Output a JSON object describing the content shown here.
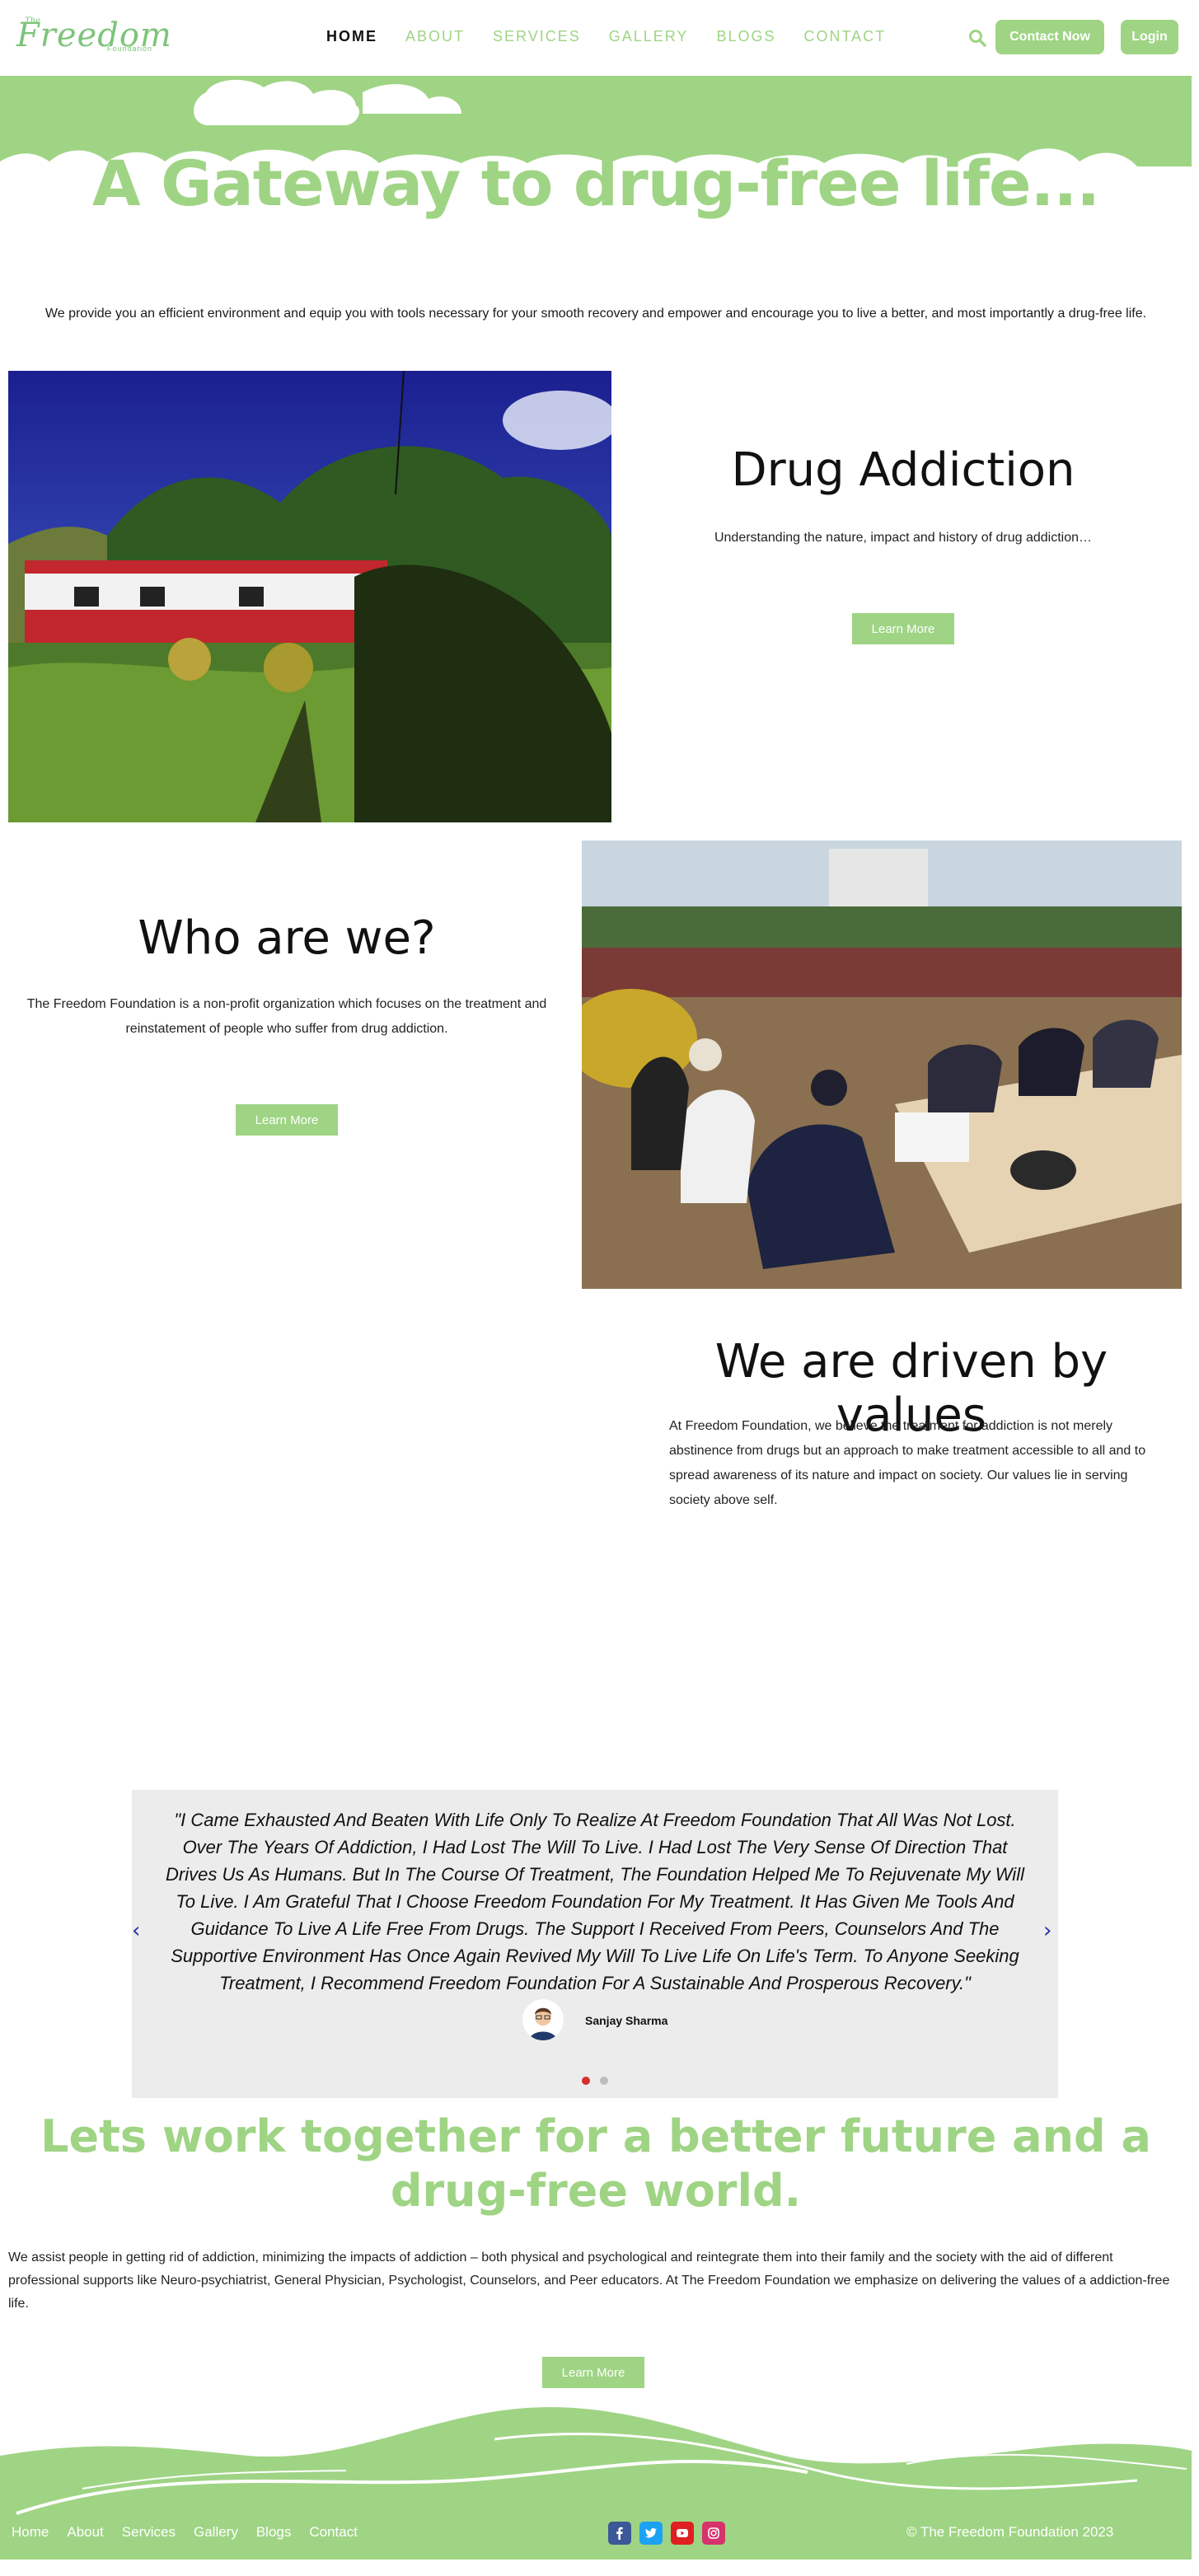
{
  "header": {
    "logo": {
      "small": "The",
      "main": "Freedom",
      "sub": "Foundation"
    },
    "nav": [
      {
        "label": "HOME",
        "active": true
      },
      {
        "label": "ABOUT",
        "active": false
      },
      {
        "label": "SERVICES",
        "active": false
      },
      {
        "label": "GALLERY",
        "active": false
      },
      {
        "label": "BLOGS",
        "active": false
      },
      {
        "label": "CONTACT",
        "active": false
      }
    ],
    "search_icon": "search-icon",
    "contact_button": "Contact Now",
    "login_button": "Login"
  },
  "hero": {
    "title": "A Gateway to drug-free life...",
    "intro": "We provide you an efficient environment and equip you with tools necessary for your smooth recovery and empower and encourage you to live a better, and most importantly a drug-free life."
  },
  "drug_addiction": {
    "title": "Drug Addiction",
    "text": "Understanding the nature, impact and history of drug addiction…",
    "button": "Learn More"
  },
  "who_are_we": {
    "title": "Who are we?",
    "text": "The Freedom Foundation is a non-profit organization which focuses on the treatment and reinstatement of people who suffer from drug addiction.",
    "button": "Learn More"
  },
  "values": {
    "title": "We are driven by values",
    "text": "At Freedom Foundation, we believe the treatment for addiction is not merely abstinence from drugs but an approach to make treatment accessible to all and to spread awareness of its nature and impact on society. Our values lie in serving society above self."
  },
  "testimonial": {
    "quote": "\"I Came Exhausted And Beaten With Life Only To Realize At Freedom Foundation That All Was Not Lost. Over The Years Of Addiction, I Had Lost The Will To Live. I Had Lost The Very Sense Of Direction That Drives Us As Humans. But In The Course Of Treatment, The Foundation Helped Me To Rejuvenate My Will To Live. I Am Grateful That I Choose Freedom Foundation For My Treatment. It Has Given Me Tools And Guidance To Live A Life Free From Drugs. The Support I Received From Peers, Counselors And The Supportive Environment Has Once Again Revived My Will To Live Life On Life's Term. To Anyone Seeking Treatment, I Recommend Freedom Foundation For A Sustainable And Prosperous Recovery.\"",
    "author": "Sanjay Sharma",
    "prev_arrow": "‹",
    "next_arrow": "›",
    "dots": [
      {
        "active": true
      },
      {
        "active": false
      }
    ]
  },
  "cta": {
    "title": "Lets work together for a better future and a drug-free world.",
    "text": "We assist people in getting rid of  addiction, minimizing the impacts of addiction – both physical and psychological and reintegrate them into their family and the society with the aid of different professional supports like Neuro-psychiatrist, General Physician, Psychologist, Counselors, and Peer educators. At The Freedom Foundation we emphasize on delivering the values of a addiction-free life.",
    "button": "Learn More"
  },
  "footer": {
    "links": [
      "Home",
      "About",
      "Services",
      "Gallery",
      "Blogs",
      "Contact"
    ],
    "social": [
      {
        "icon": "facebook-icon",
        "glyph": "f",
        "color": "#3b5998"
      },
      {
        "icon": "twitter-icon",
        "glyph": "t",
        "color": "#1da1f2"
      },
      {
        "icon": "youtube-icon",
        "glyph": "▶",
        "color": "#e02020"
      },
      {
        "icon": "instagram-icon",
        "glyph": "◎",
        "color": "#d6336c"
      }
    ],
    "copyright": "© The Freedom Foundation 2023"
  },
  "colors": {
    "accent": "#9fd484",
    "testimonial_bg": "#ececec",
    "dot_active": "#d32f2f",
    "dot_inactive": "#bdbdbd",
    "arrow": "#2233aa"
  }
}
